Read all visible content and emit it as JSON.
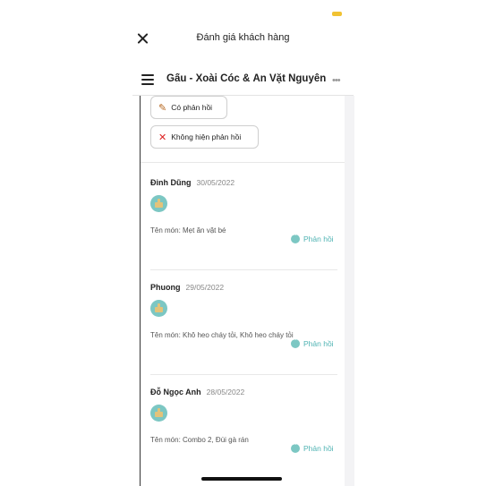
{
  "header": {
    "title": "Đánh giá khách hàng",
    "shop_name": "Gấu - Xoài Cóc & Ăn Vặt Nguyễn ...",
    "more_label": "•••"
  },
  "filters": [
    {
      "icon": "✎",
      "label": "Có phản hồi"
    },
    {
      "icon": "✕",
      "label": "Không hiện phản hồi"
    }
  ],
  "reply_label": "Phản hồi",
  "reviews": [
    {
      "name": "Đinh Dũng",
      "date": "30/05/2022",
      "dish": "Tên món: Mẹt ăn vặt bé"
    },
    {
      "name": "Phuong",
      "date": "29/05/2022",
      "dish": "Tên món: Khô heo cháy tỏi, Khô heo cháy tỏi"
    },
    {
      "name": "Đỗ Ngọc Anh",
      "date": "28/05/2022",
      "dish": "Tên món: Combo 2, Đùi gà rán"
    }
  ],
  "colors": {
    "accent": "#4fb3b3",
    "battery": "#f1c232"
  }
}
